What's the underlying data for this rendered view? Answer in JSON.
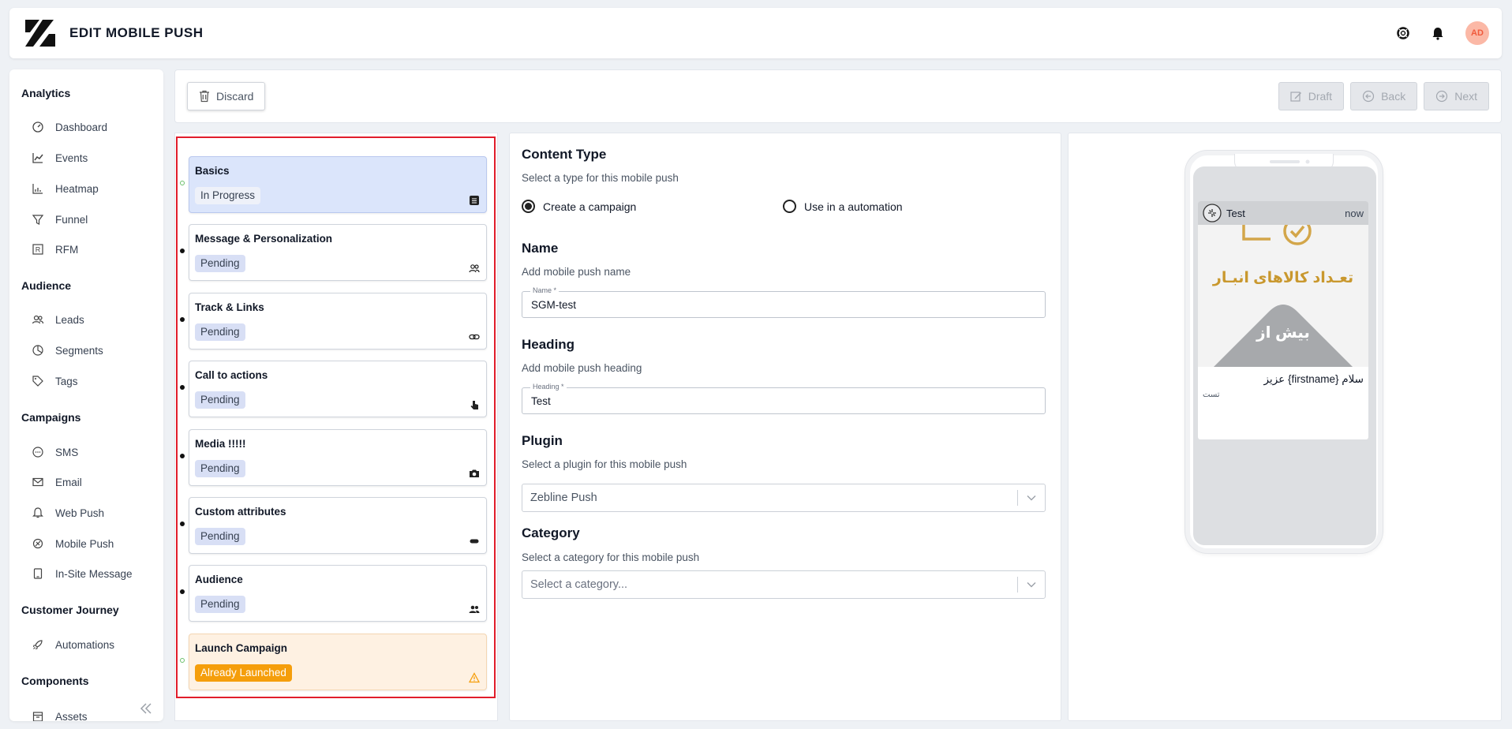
{
  "header": {
    "title": "EDIT MOBILE PUSH",
    "avatar_initials": "AD"
  },
  "sidebar": {
    "sections": [
      {
        "label": "Analytics",
        "items": [
          "Dashboard",
          "Events",
          "Heatmap",
          "Funnel",
          "RFM"
        ]
      },
      {
        "label": "Audience",
        "items": [
          "Leads",
          "Segments",
          "Tags"
        ]
      },
      {
        "label": "Campaigns",
        "items": [
          "SMS",
          "Email",
          "Web Push",
          "Mobile Push",
          "In-Site Message"
        ]
      },
      {
        "label": "Customer Journey",
        "items": [
          "Automations"
        ]
      },
      {
        "label": "Components",
        "items": [
          "Assets"
        ]
      }
    ]
  },
  "toolbar": {
    "discard": "Discard",
    "draft": "Draft",
    "back": "Back",
    "next": "Next"
  },
  "steps": [
    {
      "title": "Basics",
      "status": "In Progress",
      "icon": "list-icon"
    },
    {
      "title": "Message & Personalization",
      "status": "Pending",
      "icon": "users-icon"
    },
    {
      "title": "Track & Links",
      "status": "Pending",
      "icon": "link-icon"
    },
    {
      "title": "Call to actions",
      "status": "Pending",
      "icon": "pointer-icon"
    },
    {
      "title": "Media !!!!!",
      "status": "Pending",
      "icon": "camera-icon"
    },
    {
      "title": "Custom attributes",
      "status": "Pending",
      "icon": "tag-icon"
    },
    {
      "title": "Audience",
      "status": "Pending",
      "icon": "group-icon"
    },
    {
      "title": "Launch Campaign",
      "status": "Already Launched",
      "icon": "warning-icon"
    }
  ],
  "form": {
    "content_type": {
      "title": "Content Type",
      "subtitle": "Select a type for this mobile push",
      "option_campaign": "Create a campaign",
      "option_automation": "Use in a automation"
    },
    "name": {
      "title": "Name",
      "subtitle": "Add mobile push name",
      "label": "Name *",
      "value": "SGM-test"
    },
    "heading": {
      "title": "Heading",
      "subtitle": "Add mobile push heading",
      "label": "Heading *",
      "value": "Test"
    },
    "plugin": {
      "title": "Plugin",
      "subtitle": "Select a plugin for this mobile push",
      "value": "Zebline Push"
    },
    "category": {
      "title": "Category",
      "subtitle": "Select a category for this mobile push",
      "placeholder": "Select a category..."
    }
  },
  "preview": {
    "app_name": "Test",
    "time": "now",
    "image_text_1": "تعـداد کالاهای انبـار",
    "image_text_2": "بیش از",
    "title": "سلام {firstname} عزیز",
    "body": "تست"
  },
  "colors": {
    "accent": "#dbe5fb",
    "warning": "#f59e0b",
    "highlight": "#e11d2b",
    "avatar": "#fbb8a6"
  }
}
